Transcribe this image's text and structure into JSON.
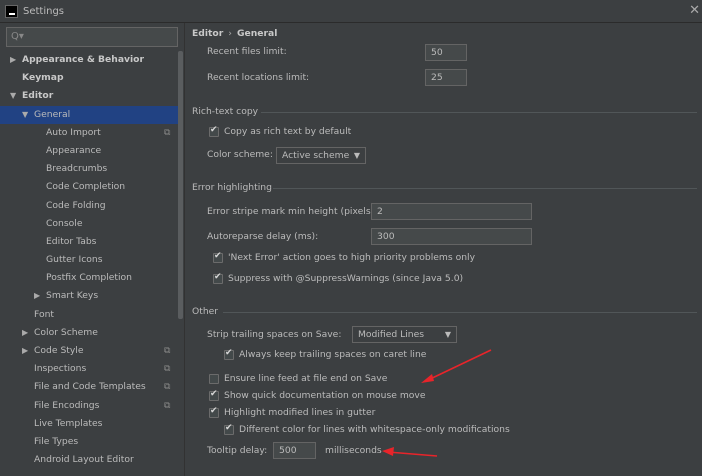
{
  "window": {
    "title": "Settings"
  },
  "search": {
    "placeholder": ""
  },
  "sidebar": {
    "items": [
      {
        "label": "Appearance & Behavior",
        "arrow": "▶",
        "bold": true,
        "level": 0
      },
      {
        "label": "Keymap",
        "arrow": "",
        "bold": true,
        "level": 0
      },
      {
        "label": "Editor",
        "arrow": "▼",
        "bold": true,
        "level": 0
      },
      {
        "label": "General",
        "arrow": "▼",
        "bold": false,
        "level": 1,
        "selected": true
      },
      {
        "label": "Auto Import",
        "arrow": "",
        "level": 2,
        "copy": true
      },
      {
        "label": "Appearance",
        "arrow": "",
        "level": 2
      },
      {
        "label": "Breadcrumbs",
        "arrow": "",
        "level": 2
      },
      {
        "label": "Code Completion",
        "arrow": "",
        "level": 2
      },
      {
        "label": "Code Folding",
        "arrow": "",
        "level": 2
      },
      {
        "label": "Console",
        "arrow": "",
        "level": 2
      },
      {
        "label": "Editor Tabs",
        "arrow": "",
        "level": 2
      },
      {
        "label": "Gutter Icons",
        "arrow": "",
        "level": 2
      },
      {
        "label": "Postfix Completion",
        "arrow": "",
        "level": 2
      },
      {
        "label": "Smart Keys",
        "arrow": "▶",
        "level": 2
      },
      {
        "label": "Font",
        "arrow": "",
        "level": 1
      },
      {
        "label": "Color Scheme",
        "arrow": "▶",
        "level": 1
      },
      {
        "label": "Code Style",
        "arrow": "▶",
        "level": 1,
        "copy": true
      },
      {
        "label": "Inspections",
        "arrow": "",
        "level": 1,
        "copy": true
      },
      {
        "label": "File and Code Templates",
        "arrow": "",
        "level": 1,
        "copy": true
      },
      {
        "label": "File Encodings",
        "arrow": "",
        "level": 1,
        "copy": true
      },
      {
        "label": "Live Templates",
        "arrow": "",
        "level": 1
      },
      {
        "label": "File Types",
        "arrow": "",
        "level": 1
      },
      {
        "label": "Android Layout Editor",
        "arrow": "",
        "level": 1
      }
    ]
  },
  "breadcrumb": {
    "parent": "Editor",
    "separator": "›",
    "current": "General"
  },
  "recent": {
    "files_label": "Recent files limit:",
    "files_value": "50",
    "locations_label": "Recent locations limit:",
    "locations_value": "25"
  },
  "rich_text": {
    "title": "Rich-text copy",
    "copy_label": "Copy as rich text by default",
    "copy_checked": true,
    "scheme_label": "Color scheme:",
    "scheme_value": "Active scheme"
  },
  "error": {
    "title": "Error highlighting",
    "stripe_label": "Error stripe mark min height (pixels):",
    "stripe_value": "2",
    "reparse_label": "Autoreparse delay (ms):",
    "reparse_value": "300",
    "next_error_label": "'Next Error' action goes to high priority problems only",
    "suppress_label": "Suppress with @SuppressWarnings (since Java 5.0)"
  },
  "other": {
    "title": "Other",
    "strip_label": "Strip trailing spaces on Save:",
    "strip_value": "Modified Lines",
    "keep_label": "Always keep trailing spaces on caret line",
    "linefeed_label": "Ensure line feed at file end on Save",
    "quickdoc_label": "Show quick documentation on mouse move",
    "highlight_label": "Highlight modified lines in gutter",
    "whitespace_label": "Different color for lines with whitespace-only modifications",
    "tooltip_label": "Tooltip delay:",
    "tooltip_value": "500",
    "tooltip_unit": "milliseconds"
  },
  "colors": {
    "annotation_arrow": "#e8242a",
    "selection": "#214283"
  }
}
